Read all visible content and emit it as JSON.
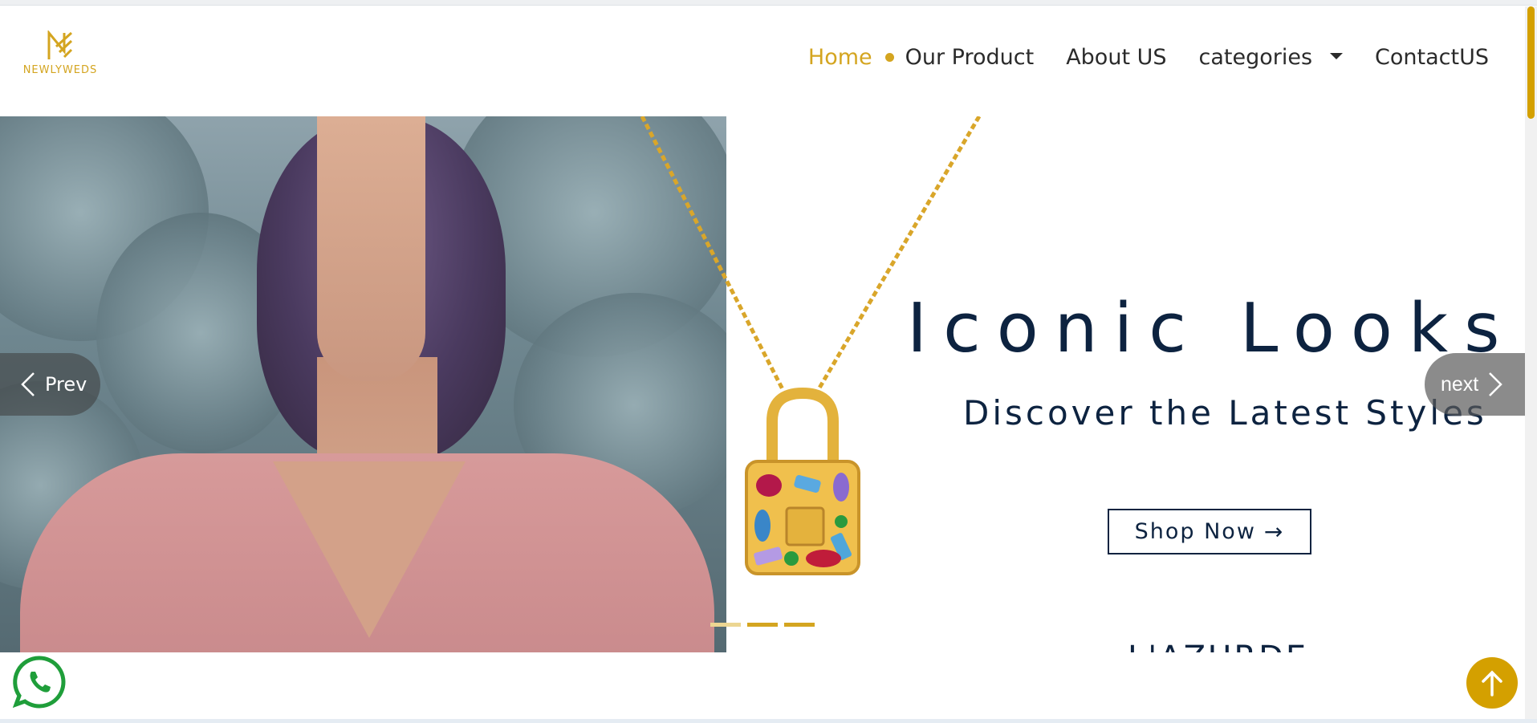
{
  "brand": {
    "logo_text": "NEWLYWEDS",
    "accent_color": "#d4a520"
  },
  "nav": {
    "home": "Home",
    "our_product": "Our Product",
    "about": "About US",
    "categories": "categories",
    "contact": "ContactUS"
  },
  "hero": {
    "title": "Iconic Looks",
    "subtitle": "Discover the Latest Styles",
    "shop_label": "Shop Now",
    "shop_arrow": "→",
    "brand_text": "L'AZURDE",
    "prev_label": "Prev",
    "next_label": "next",
    "slides_active": 2,
    "slides_total": 3
  },
  "icons": {
    "whatsapp": "whatsapp-icon",
    "back_to_top": "arrow-up-icon",
    "prev": "chevron-left-icon",
    "next": "chevron-right-icon"
  }
}
